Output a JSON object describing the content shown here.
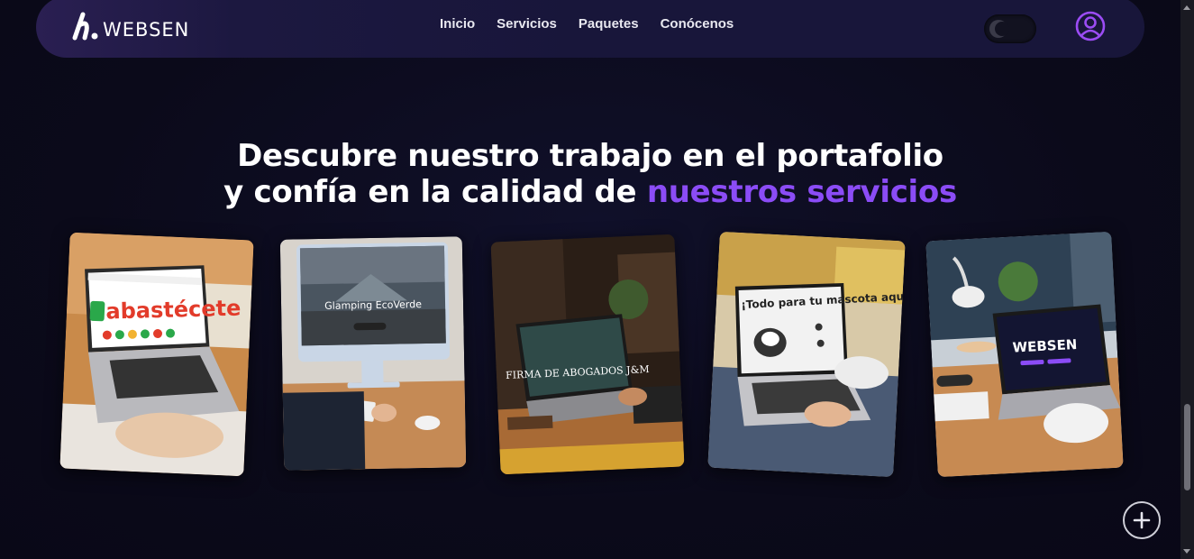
{
  "brand": {
    "name": "WEBSEN",
    "accent": "#8b4cf6"
  },
  "nav": {
    "links": [
      "Inicio",
      "Servicios",
      "Paquetes",
      "Conócenos"
    ]
  },
  "hero": {
    "line1": "Descubre nuestro trabajo en el portafolio",
    "line2_prefix": "y confía en la calidad de ",
    "line2_accent": "nuestros servicios"
  },
  "portfolio": [
    {
      "label": "abastécete"
    },
    {
      "label": "Glamping EcoVerde"
    },
    {
      "label": "FIRMA DE ABOGADOS J&M"
    },
    {
      "label": "¡Todo para tu mascota aquí!"
    },
    {
      "label": "WEBSEN"
    }
  ],
  "icons": {
    "user": "user-circle-icon",
    "toggle": "moon-icon",
    "add": "plus-icon"
  }
}
